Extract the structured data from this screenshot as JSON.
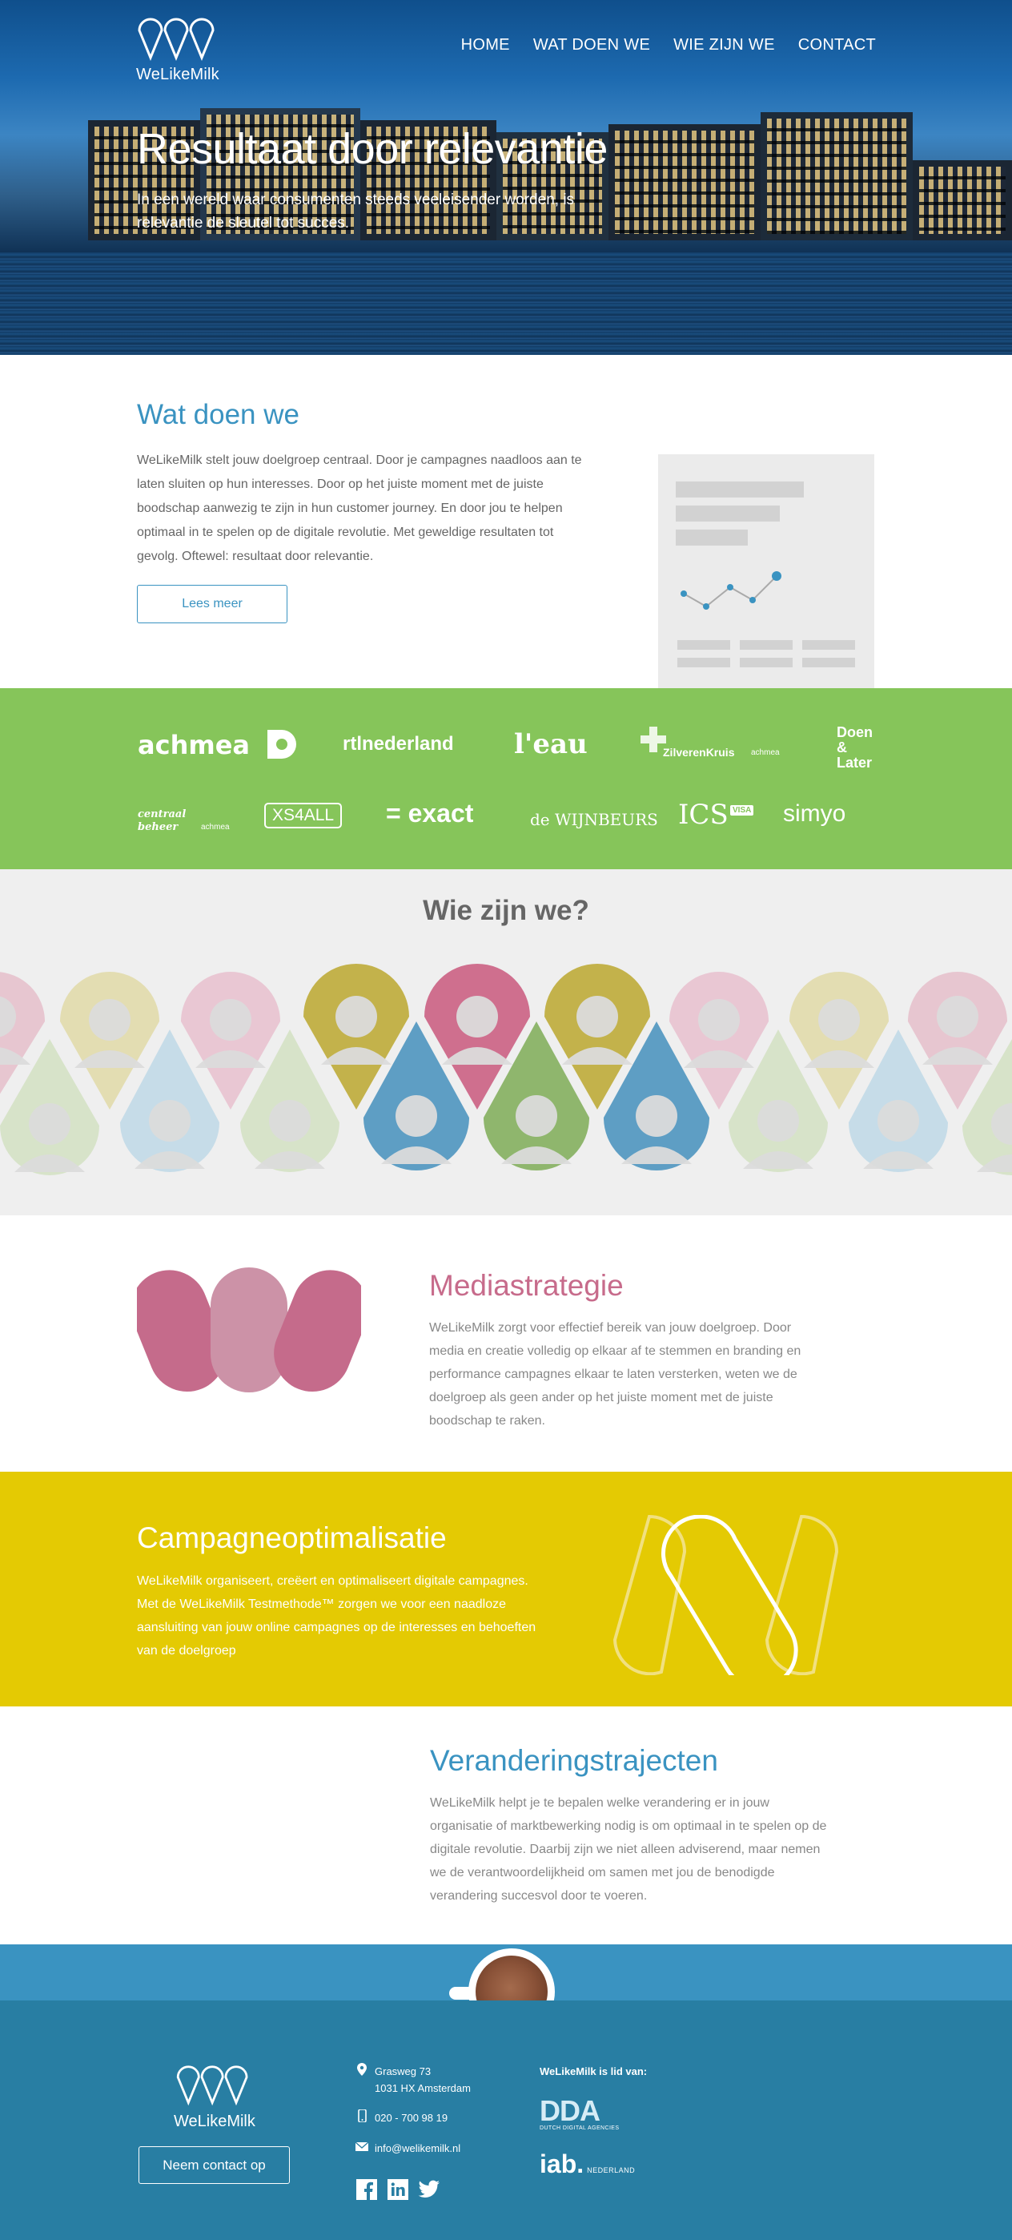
{
  "brand": {
    "name": "WeLikeMilk"
  },
  "nav": {
    "items": [
      "HOME",
      "WAT DOEN WE",
      "WIE ZIJN WE",
      "CONTACT"
    ]
  },
  "hero": {
    "title": "Resultaat door relevantie",
    "subtitle": "In een wereld waar consumenten steeds veeleisender worden, is relevantie de sleutel tot succes."
  },
  "wat": {
    "heading": "Wat doen we",
    "body": "WeLikeMilk stelt jouw doelgroep centraal. Door je campagnes naadloos aan te laten sluiten op hun interesses. Door op het juiste moment met de juiste boodschap aanwezig te zijn in hun customer journey. En door jou te helpen optimaal in te spelen op de digitale revolutie. Met geweldige resultaten tot gevolg. Oftewel: resultaat door relevantie.",
    "button": "Lees meer"
  },
  "clients": {
    "row1": [
      "achmea",
      "rtlnederland",
      "l'eau",
      "ZilverenKruis",
      "achmea",
      "Doen",
      "&",
      "Later"
    ],
    "row2": [
      "centraal",
      "beheer",
      "achmea",
      "XS4ALL",
      "= exact",
      "de WIJNBEURS",
      "ICS",
      "VISA",
      "simyo"
    ]
  },
  "wie": {
    "heading": "Wie zijn we?"
  },
  "services": {
    "media": {
      "title": "Mediastrategie",
      "text": "WeLikeMilk zorgt voor effectief bereik van jouw doelgroep. Door media en creatie volledig op elkaar af te stemmen en branding en performance campagnes elkaar te laten versterken, weten we de doelgroep als geen ander op het juiste moment met de juiste boodschap te raken."
    },
    "campagne": {
      "title": "Campagneoptimalisatie",
      "text": "WeLikeMilk organiseert, creëert en optimaliseert digitale campagnes. Met de WeLikeMilk Testmethode™ zorgen we voor een naadloze aansluiting van jouw online campagnes op de interesses en behoeften van de doelgroep"
    },
    "verander": {
      "title": "Veranderingstrajecten",
      "text": "WeLikeMilk helpt je te bepalen welke verandering er in jouw organisatie of marktbewerking nodig is om optimaal in te spelen op de digitale revolutie. Daarbij zijn we niet alleen adviserend, maar nemen we de verantwoordelijkheid om samen met jou de benodigde verandering succesvol door te voeren."
    }
  },
  "footer": {
    "brand": "WeLikeMilk",
    "contact_button": "Neem contact op",
    "address_line1": "Grasweg 73",
    "address_line2": "1031 HX Amsterdam",
    "phone": "020 - 700 98 19",
    "email": "info@welikemilk.nl",
    "member_label": "WeLikeMilk is lid van:",
    "dda_name": "DDA",
    "dda_sub": "DUTCH DIGITAL AGENCIES",
    "iab_name": "iab.",
    "iab_sub": "NEDERLAND"
  },
  "colors": {
    "primary_blue": "#3a93c1",
    "green": "#86c55a",
    "pink": "#c76b8b",
    "yellow": "#e4ca03",
    "footer_blue": "#287ea3"
  }
}
